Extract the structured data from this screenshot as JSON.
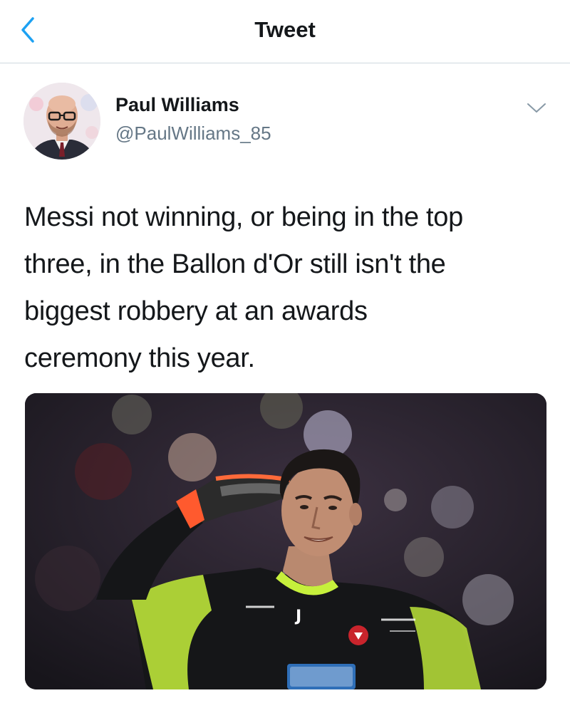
{
  "header": {
    "title": "Tweet",
    "back_icon": "chevron-left-icon",
    "accent_color": "#1da1f2"
  },
  "tweet": {
    "author": {
      "name": "Paul Williams",
      "handle": "@PaulWilliams_85",
      "avatar": "profile-photo"
    },
    "menu_icon": "chevron-down-icon",
    "text_lines": [
      "Messi not winning, or being in the top",
      "three, in the Ballon d'Or still isn't the",
      "biggest robbery at an awards",
      "ceremony this year."
    ],
    "media": {
      "kind": "photo",
      "jersey_brand_mark": "J"
    }
  },
  "colors": {
    "text_primary": "#14171a",
    "text_secondary": "#657786",
    "divider": "#cfd9de",
    "jersey_accent": "#c6f03c"
  }
}
